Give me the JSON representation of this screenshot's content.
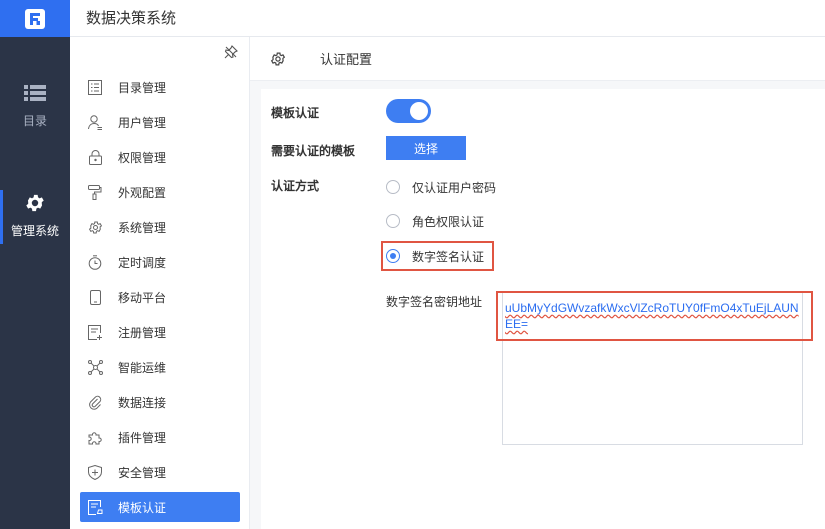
{
  "app": {
    "title": "数据决策系统"
  },
  "rail": {
    "items": [
      {
        "label": "目录",
        "icon": "list-icon"
      },
      {
        "label": "管理系统",
        "icon": "gear-icon"
      }
    ]
  },
  "menu": {
    "items": [
      {
        "label": "目录管理",
        "icon": "catalog-icon"
      },
      {
        "label": "用户管理",
        "icon": "user-icon"
      },
      {
        "label": "权限管理",
        "icon": "lock-icon"
      },
      {
        "label": "外观配置",
        "icon": "paint-roller-icon"
      },
      {
        "label": "系统管理",
        "icon": "settings-icon"
      },
      {
        "label": "定时调度",
        "icon": "timer-icon"
      },
      {
        "label": "移动平台",
        "icon": "mobile-icon"
      },
      {
        "label": "注册管理",
        "icon": "register-icon"
      },
      {
        "label": "智能运维",
        "icon": "network-icon"
      },
      {
        "label": "数据连接",
        "icon": "link-icon"
      },
      {
        "label": "插件管理",
        "icon": "puzzle-icon"
      },
      {
        "label": "安全管理",
        "icon": "shield-icon"
      },
      {
        "label": "模板认证",
        "icon": "template-auth-icon"
      }
    ],
    "active": "模板认证"
  },
  "content": {
    "header_title": "认证配置",
    "template_auth_label": "模板认证",
    "template_auth_enabled": true,
    "need_auth_label": "需要认证的模板",
    "select_button": "选择",
    "auth_method_label": "认证方式",
    "auth_options": [
      {
        "label": "仅认证用户密码",
        "checked": false
      },
      {
        "label": "角色权限认证",
        "checked": false
      },
      {
        "label": "数字签名认证",
        "checked": true
      }
    ],
    "signature_url_label": "数字签名密钥地址",
    "signature_url_value": "uUbMyYdGWvzafkWxcVlZcRoTUY0fFmO4xTuEjLAUNEE="
  },
  "colors": {
    "accent": "#3e7ef2",
    "rail_bg": "#2b3447",
    "highlight": "#e05542"
  }
}
